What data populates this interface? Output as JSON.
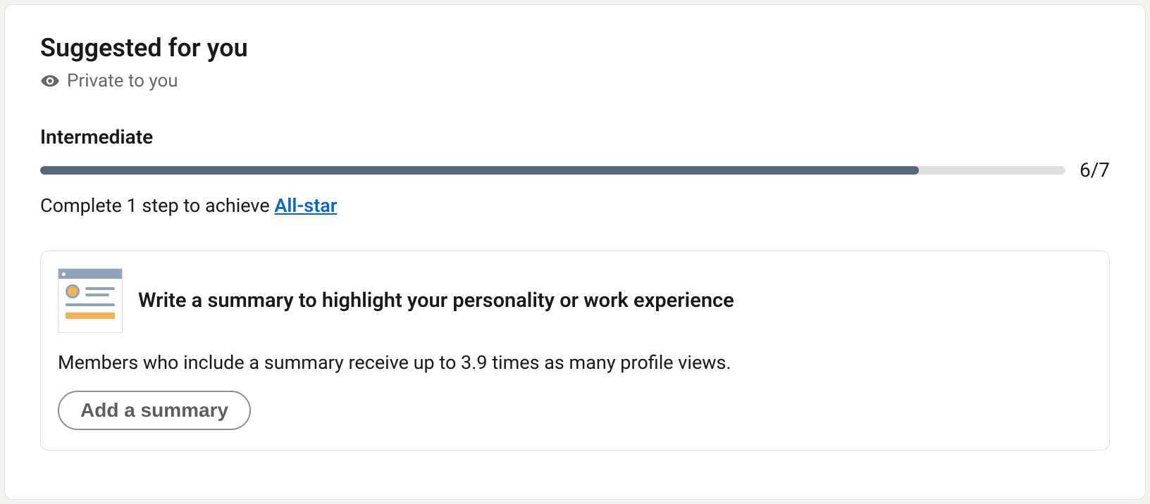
{
  "header": {
    "title": "Suggested for you",
    "privacy_label": "Private to you"
  },
  "progress": {
    "level_label": "Intermediate",
    "count_text": "6/7",
    "current": 6,
    "total": 7,
    "step_text_prefix": "Complete 1 step to achieve ",
    "step_link_label": "All-star"
  },
  "suggestion": {
    "title": "Write a summary to highlight your personality or work experience",
    "description": "Members who include a summary receive up to 3.9 times as many profile views.",
    "button_label": "Add a summary"
  }
}
